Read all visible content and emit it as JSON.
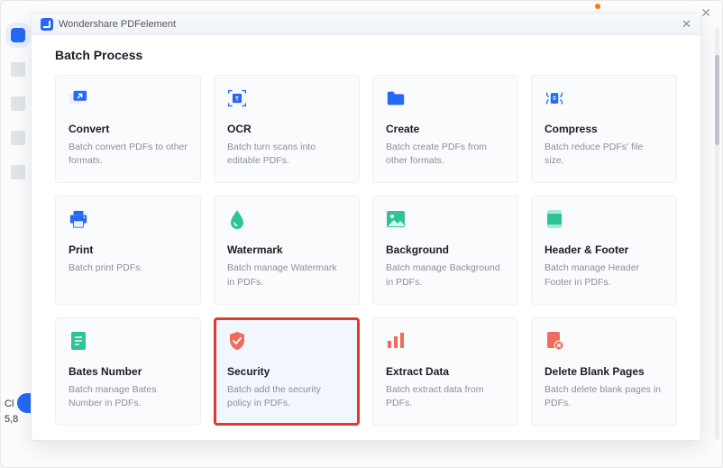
{
  "app_title": "Wondershare PDFelement",
  "bg_partial": {
    "line1": "Cl",
    "line2": "5,8"
  },
  "modal": {
    "title": "Batch Process",
    "cards": [
      {
        "id": "convert",
        "title": "Convert",
        "desc": "Batch convert PDFs to other formats."
      },
      {
        "id": "ocr",
        "title": "OCR",
        "desc": "Batch turn scans into editable PDFs."
      },
      {
        "id": "create",
        "title": "Create",
        "desc": "Batch create PDFs from other formats."
      },
      {
        "id": "compress",
        "title": "Compress",
        "desc": "Batch reduce PDFs' file size."
      },
      {
        "id": "print",
        "title": "Print",
        "desc": "Batch print PDFs."
      },
      {
        "id": "watermark",
        "title": "Watermark",
        "desc": "Batch manage Watermark in PDFs."
      },
      {
        "id": "background",
        "title": "Background",
        "desc": "Batch manage Background in PDFs."
      },
      {
        "id": "headerfooter",
        "title": "Header & Footer",
        "desc": "Batch manage Header Footer in PDFs."
      },
      {
        "id": "bates",
        "title": "Bates Number",
        "desc": "Batch manage Bates Number in PDFs."
      },
      {
        "id": "security",
        "title": "Security",
        "desc": "Batch add the security policy in PDFs."
      },
      {
        "id": "extract",
        "title": "Extract Data",
        "desc": "Batch extract data from PDFs."
      },
      {
        "id": "deleteblank",
        "title": "Delete Blank Pages",
        "desc": "Batch delete blank pages in PDFs."
      }
    ],
    "highlighted": "security"
  },
  "colors": {
    "accent": "#2669f5",
    "highlight_border": "#e03a2f",
    "green": "#2fc39a",
    "coral": "#f06a5d"
  }
}
